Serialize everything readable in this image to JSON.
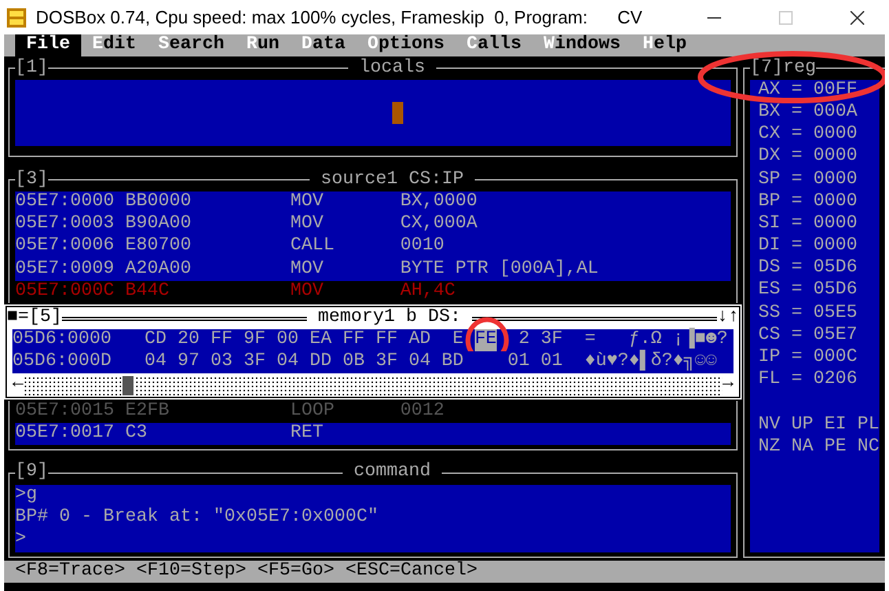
{
  "window": {
    "title": "DOSBox 0.74, Cpu speed: max 100% cycles, Frameskip  0, Program:      CV",
    "controls": [
      {
        "kind": "minimize",
        "disabled": false
      },
      {
        "kind": "maximize",
        "disabled": true
      },
      {
        "kind": "close",
        "disabled": false
      }
    ]
  },
  "menu": [
    {
      "label": "File",
      "selected": true
    },
    {
      "label": "Edit",
      "selected": false
    },
    {
      "label": "Search",
      "selected": false
    },
    {
      "label": "Run",
      "selected": false
    },
    {
      "label": "Data",
      "selected": false
    },
    {
      "label": "Options",
      "selected": false
    },
    {
      "label": "Calls",
      "selected": false
    },
    {
      "label": "Windows",
      "selected": false
    },
    {
      "label": "Help",
      "selected": false
    }
  ],
  "locals": {
    "number": "[1]",
    "title": "locals"
  },
  "source": {
    "number": "[3]",
    "title": "source1 CS:IP",
    "rows_top": [
      {
        "address": "05E7:0000",
        "bytes": "BB0000",
        "mnemonic": "MOV",
        "operands": "BX,0000",
        "kind": "code"
      },
      {
        "address": "05E7:0003",
        "bytes": "B90A00",
        "mnemonic": "MOV",
        "operands": "CX,000A",
        "kind": "code"
      },
      {
        "address": "05E7:0006",
        "bytes": "E80700",
        "mnemonic": "CALL",
        "operands": "0010",
        "kind": "code"
      },
      {
        "address": "05E7:0009",
        "bytes": "A20A00",
        "mnemonic": "MOV",
        "operands": "BYTE PTR [000A],AL",
        "kind": "code"
      },
      {
        "address": "05E7:000C",
        "bytes": "B44C",
        "mnemonic": "MOV",
        "operands": "AH,4C",
        "kind": "current"
      }
    ],
    "rows_bottom": [
      {
        "address": "05E7:0015",
        "bytes": "E2FB",
        "mnemonic": "LOOP",
        "operands": "0012",
        "kind": "dim"
      },
      {
        "address": "05E7:0017",
        "bytes": "C3",
        "mnemonic": "RET",
        "kind": "code"
      }
    ]
  },
  "memory": {
    "marker": "■=",
    "number": "[5]",
    "title": "memory1 b DS:",
    "arrows": "↓↑",
    "scroll_left": "←",
    "scroll_right": "→",
    "cursor_circled": true,
    "rows": [
      {
        "address": "05D6:0000",
        "bytes_before": "CD 20 FF 9F 00 EA FF FF AD  E ",
        "cursor": "FE",
        "bytes_after": "  2 3F",
        "ascii": "=   ƒ.Ω ¡▐■☻?"
      },
      {
        "address": "05D6:000D",
        "bytes_before": "04 97 03 3F 04 DD 0B 3F 04 BD    01 01",
        "ascii": "♦ù♥?♦▌δ?♦╗☺☺"
      }
    ]
  },
  "registers": {
    "title": "[7]reg",
    "circled": true,
    "items": [
      "AX = 00FF",
      "BX = 000A",
      "CX = 0000",
      "DX = 0000",
      "SP = 0000",
      "BP = 0000",
      "SI = 0000",
      "DI = 0000",
      "DS = 05D6",
      "ES = 05D6",
      "SS = 05E5",
      "CS = 05E7",
      "IP = 000C",
      "FL = 0206"
    ],
    "flags": [
      "NV UP EI PL",
      "NZ NA PE NC"
    ]
  },
  "command": {
    "number": "[9]",
    "title": "command",
    "lines": [
      ">g",
      "BP# 0 - Break at: \"0x05E7:0x000C\"",
      ">"
    ]
  },
  "status_bar": [
    "<F8=Trace>",
    "<F10=Step>",
    "<F5=Go>",
    "<ESC=Cancel>"
  ]
}
